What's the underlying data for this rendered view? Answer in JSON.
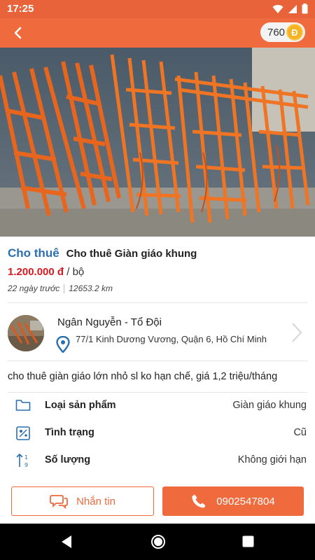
{
  "status_bar": {
    "time": "17:25"
  },
  "header": {
    "coin_count": "760",
    "coin_symbol": "Đ"
  },
  "listing": {
    "type_label": "Cho thuê",
    "title": "Cho thuê  Giàn giáo khung",
    "price": "1.200.000 đ",
    "unit": "/ bộ",
    "posted_ago": "22 ngày trước",
    "distance": "12653.2 km"
  },
  "seller": {
    "name": "Ngân Nguyễn - Tổ Đội",
    "address": "77/1 Kinh Dương Vương, Quận 6, Hồ Chí Minh"
  },
  "description": "cho thuê giàn giáo lớn nhỏ sl ko hạn chế, giá 1,2 triệu/tháng",
  "specs": [
    {
      "label": "Loại sản phẩm",
      "value": "Giàn giáo khung",
      "icon": "folder-icon"
    },
    {
      "label": "Tình trạng",
      "value": "Cũ",
      "icon": "condition-icon"
    },
    {
      "label": "Số lượng",
      "value": "Không giới hạn",
      "icon": "sort-number-icon"
    }
  ],
  "actions": {
    "message_label": "Nhắn tin",
    "phone": "0902547804"
  },
  "colors": {
    "primary": "#ef6a3c",
    "link": "#2a6fb0",
    "price": "#d71920"
  }
}
